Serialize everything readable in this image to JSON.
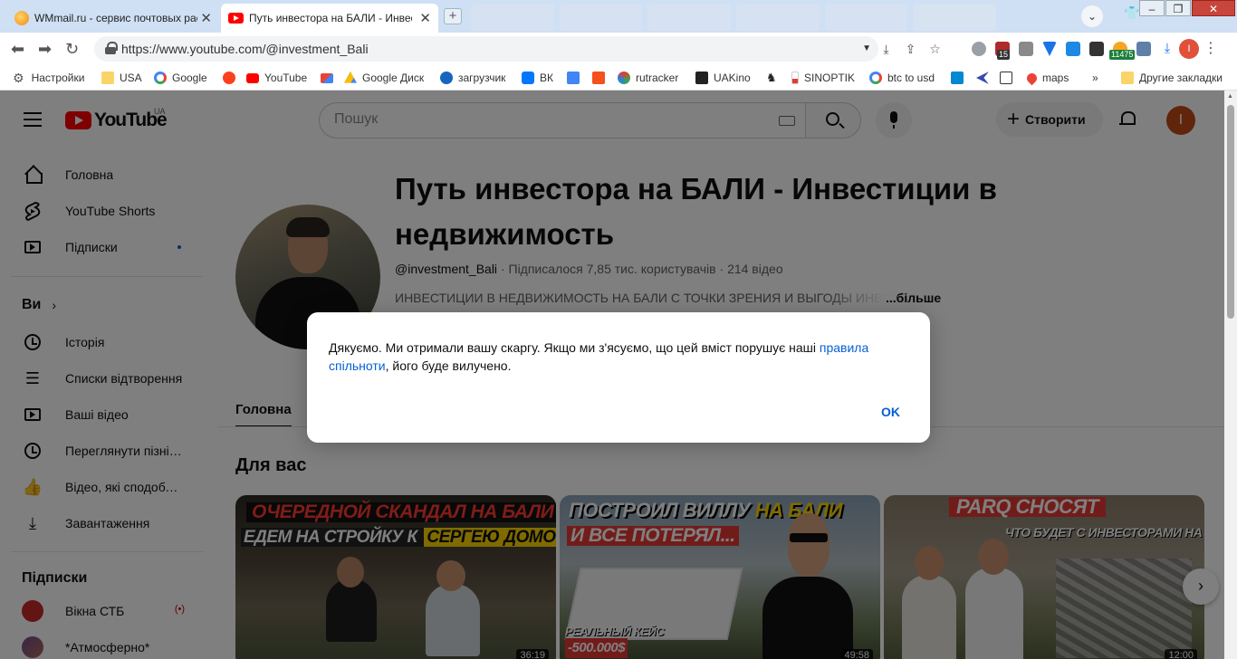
{
  "browser": {
    "tabs": [
      {
        "title": "WMmail.ru - сервис почтовых рассылок",
        "active": false
      },
      {
        "title": "Путь инвестора на БАЛИ - Инвестиции в недвижимость",
        "active": true
      }
    ],
    "url": "https://www.youtube.com/@investment_Bali",
    "window_min": "–",
    "window_max": "❐",
    "window_close": "✕",
    "extension_badge_1": "15",
    "extension_badge_2": "11475",
    "profile_letter": "I",
    "bookmarks": [
      {
        "label": "Настройки",
        "icon": "gear-icon"
      },
      {
        "label": "USA",
        "icon": "folder-icon"
      },
      {
        "label": "Google",
        "icon": "google-icon"
      },
      {
        "label": "",
        "icon": "yandex-icon"
      },
      {
        "label": "YouTube",
        "icon": "youtube-icon"
      },
      {
        "label": "",
        "icon": "gmail-icon"
      },
      {
        "label": "Google Диск",
        "icon": "drive-icon"
      },
      {
        "label": "загрузчик",
        "icon": "infinity-icon"
      },
      {
        "label": "ВК",
        "icon": "vk-icon"
      },
      {
        "label": "",
        "icon": "translate-icon"
      },
      {
        "label": "",
        "icon": "f-icon"
      },
      {
        "label": "rutracker",
        "icon": "rutracker-icon"
      },
      {
        "label": "UAKino",
        "icon": "uakino-icon"
      },
      {
        "label": "",
        "icon": "chess-icon"
      },
      {
        "label": "SINOPTIK",
        "icon": "thermometer-icon"
      },
      {
        "label": "btc to usd",
        "icon": "google-icon"
      },
      {
        "label": "",
        "icon": "p-icon"
      },
      {
        "label": "",
        "icon": "arrow-icon"
      },
      {
        "label": "",
        "icon": "bc-icon"
      },
      {
        "label": "maps",
        "icon": "maps-icon"
      }
    ],
    "bookmarks_overflow": "»",
    "other_bookmarks": "Другие закладки"
  },
  "youtube": {
    "logo_text": "YouTube",
    "country_code": "UA",
    "search_placeholder": "Пошук",
    "create_label": "Створити",
    "avatar_letter": "I",
    "sidebar": {
      "main": [
        {
          "label": "Головна",
          "icon": "home-icon"
        },
        {
          "label": "YouTube Shorts",
          "icon": "shorts-icon"
        },
        {
          "label": "Підписки",
          "icon": "subscriptions-icon"
        }
      ],
      "you_heading": "Ви",
      "you_items": [
        {
          "label": "Історія",
          "icon": "history-icon"
        },
        {
          "label": "Списки відтворення",
          "icon": "playlist-icon"
        },
        {
          "label": "Ваші відео",
          "icon": "your-videos-icon"
        },
        {
          "label": "Переглянути пізніше",
          "icon": "watch-later-icon"
        },
        {
          "label": "Відео, які сподобалися",
          "icon": "like-icon"
        },
        {
          "label": "Завантаження",
          "icon": "download-icon"
        }
      ],
      "subs_heading": "Підписки",
      "subs": [
        {
          "label": "Вікна СТБ",
          "live": "(•)"
        },
        {
          "label": "*Атмосферно*"
        }
      ]
    },
    "channel": {
      "title": "Путь инвестора на БАЛИ - Инвестиции в недвижимость",
      "handle": "@investment_Bali",
      "subscribers": "Підписалося 7,85 тис. користувачів",
      "videos": "214 відео",
      "description": "ИНВЕСТИЦИИ В НЕДВИЖИМОСТЬ НА БАЛИ С ТОЧКИ ЗРЕНИЯ И ВЫГОДЫ ИНВЕСТОРА",
      "more": "...більше",
      "tab": "Головна",
      "section": "Для вас"
    },
    "videos": [
      {
        "caption1": "ОЧЕРЕДНОЙ СКАНДАЛ НА БАЛИ",
        "caption2a": "ЕДЕМ НА СТРОЙКУ К ",
        "caption2b": "СЕРГЕЮ ДОМОГАЦКОМУ",
        "duration": "36:19"
      },
      {
        "caption1a": "ПОСТРОИЛ ВИЛЛУ ",
        "caption1b": "НА БАЛИ",
        "caption2": "И ВСЕ ПОТЕРЯЛ...",
        "badge1": "РЕАЛЬНЫЙ КЕЙС",
        "badge2": "-500.000$",
        "duration": "49:58"
      },
      {
        "caption1": "PARQ СНОСЯТ",
        "caption2": "ЧТО БУДЕТ С ИНВЕСТОРАМИ НА БАЛИ?",
        "duration": "12:00"
      }
    ]
  },
  "dialog": {
    "text_before": "Дякуємо. Ми отримали вашу скаргу. Якщо ми з'ясуємо, що цей вміст порушує наші",
    "link": "правила спільноти",
    "text_after": ", його буде вилучено.",
    "ok": "OK"
  },
  "colors": {
    "accent": "#065fd4",
    "youtube_red": "#ff0000",
    "overlay": "#000000"
  }
}
